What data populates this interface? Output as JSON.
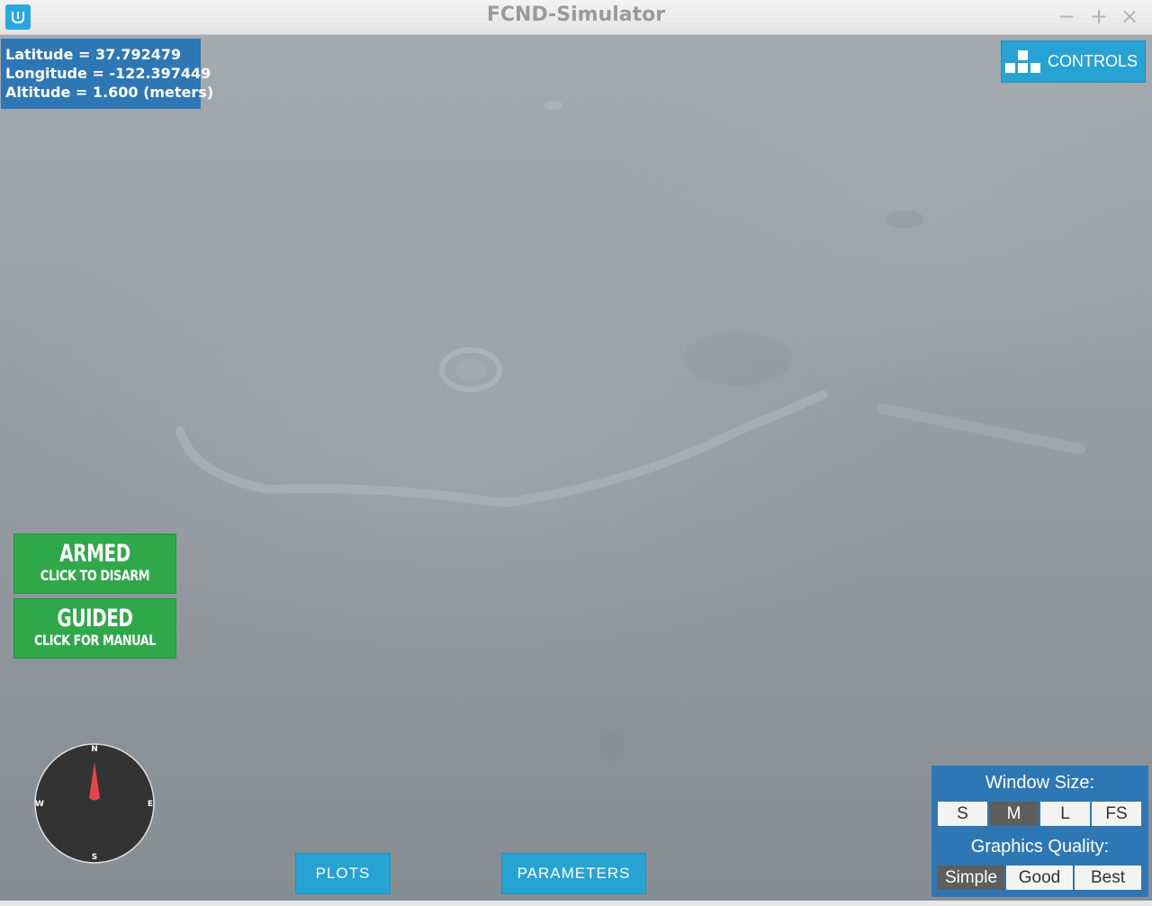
{
  "window": {
    "title": "FCND-Simulator",
    "app_icon": "udacity-logo-icon",
    "controls": [
      "minimize-icon",
      "maximize-icon",
      "close-icon"
    ],
    "glyphs": {
      "minimize": "−",
      "maximize": "+",
      "close": "×"
    }
  },
  "gps": {
    "latitude": "Latitude = 37.792479",
    "longitude": "Longitude = -122.397449",
    "altitude": "Altitude = 1.600 (meters)"
  },
  "controls_button": {
    "label": "CONTROLS",
    "icon": "blocks-icon"
  },
  "armed_button": {
    "title": "ARMED",
    "subtitle": "CLICK TO DISARM"
  },
  "guided_button": {
    "title": "GUIDED",
    "subtitle": "CLICK FOR MANUAL"
  },
  "compass": {
    "north": "N",
    "south": "S",
    "east": "E",
    "west": "W",
    "heading_deg": 0
  },
  "bottom_buttons": {
    "plots": "PLOTS",
    "parameters": "PARAMETERS"
  },
  "settings": {
    "window_size_label": "Window Size:",
    "window_sizes": [
      "S",
      "M",
      "L",
      "FS"
    ],
    "window_size_selected": "M",
    "graphics_quality_label": "Graphics Quality:",
    "graphics_qualities": [
      "Simple",
      "Good",
      "Best"
    ],
    "graphics_quality_selected": "Simple"
  },
  "colors": {
    "panel_blue": "#2e77b5",
    "button_cyan": "#27a3d3",
    "status_green": "#2fa84a",
    "compass_needle": "#e8444c"
  }
}
